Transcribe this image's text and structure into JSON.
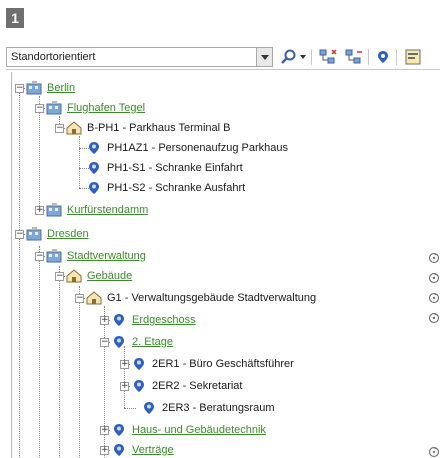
{
  "badge": "1",
  "toolbar": {
    "view_select": "Standortorientiert",
    "icons": [
      "dropdown-arrow-icon",
      "search-icon",
      "chevron-down-icon",
      "tree-expand-icon",
      "tree-collapse-icon",
      "location-pin-icon",
      "panel-icon"
    ]
  },
  "tree": {
    "berlin": "Berlin",
    "flughafen": "Flughafen Tegel",
    "bph1": "B-PH1 - Parkhaus Terminal B",
    "ph1az1": "PH1AZ1 - Personenaufzug Parkhaus",
    "ph1s1": "PH1-S1 - Schranke Einfahrt",
    "ph1s2": "PH1-S2 - Schranke Ausfahrt",
    "kurfuerstendamm": "Kurfürstendamm",
    "dresden": "Dresden",
    "stadtverwaltung": "Stadtverwaltung",
    "gebaeude": "Gebäude",
    "g1": "G1 - Verwaltungsgebäude Stadtverwaltung",
    "erdgeschoss": "Erdgeschoss",
    "etage2": "2. Etage",
    "2er1": "2ER1 - Büro Geschäftsführer",
    "2er2": "2ER2 - Sekretariat",
    "2er3": "2ER3 - Beratungsraum",
    "haustechnik": "Haus- und Gebäudetechnik",
    "vertraege": "Verträge"
  },
  "colors": {
    "link": "#3c8c2e",
    "badge": "#6f6f6f",
    "pin": "#2f5fc4"
  }
}
